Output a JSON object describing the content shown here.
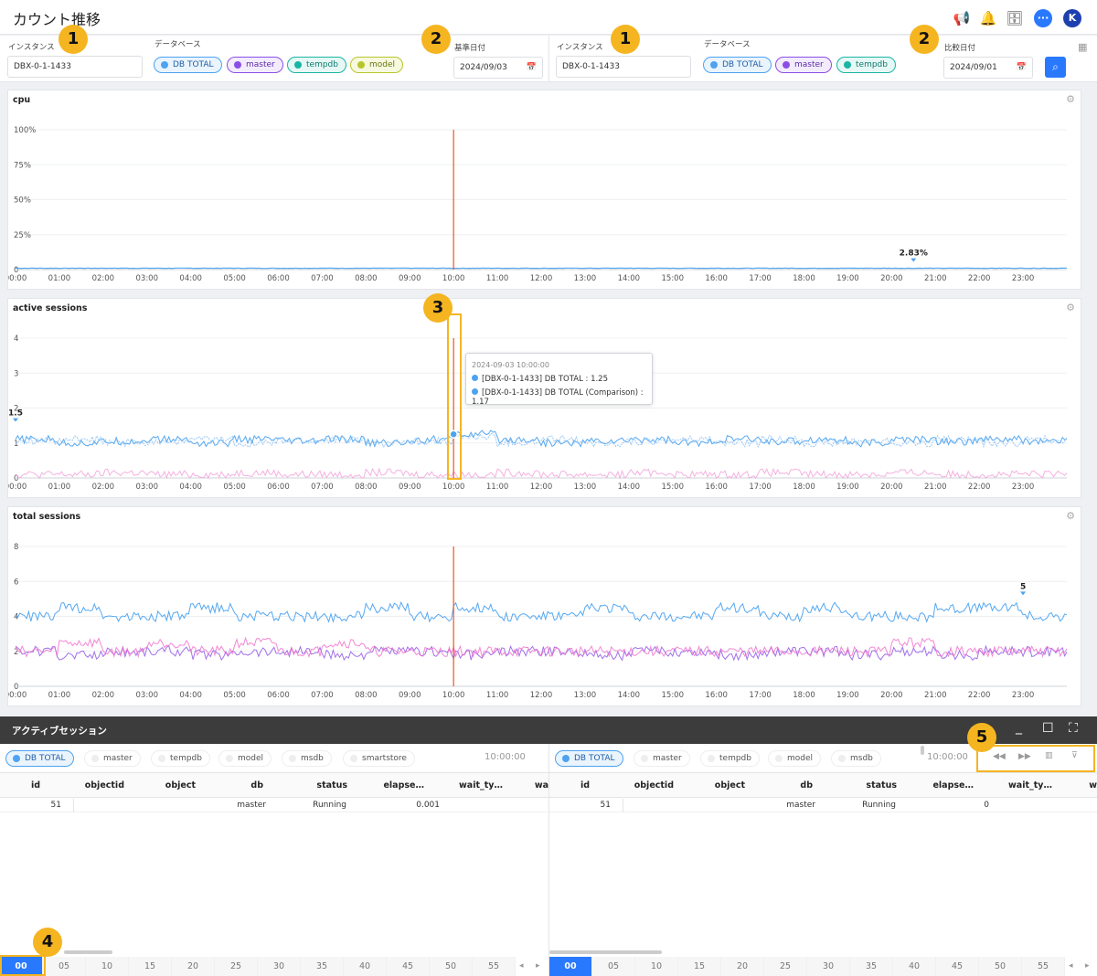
{
  "header": {
    "title": "カウント推移"
  },
  "filters": {
    "left": {
      "instance_label": "インスタンス",
      "instance_value": "DBX-0-1-1433",
      "database_label": "データベース",
      "chips": [
        "DB TOTAL",
        "master",
        "tempdb",
        "model"
      ],
      "date_label": "基準日付",
      "date_value": "2024/09/03"
    },
    "right": {
      "instance_label": "インスタンス",
      "instance_value": "DBX-0-1-1433",
      "database_label": "データベース",
      "chips": [
        "DB TOTAL",
        "master",
        "tempdb"
      ],
      "date_label": "比較日付",
      "date_value": "2024/09/01"
    }
  },
  "badges": [
    "1",
    "2",
    "1",
    "2",
    "3",
    "4",
    "5"
  ],
  "colors": {
    "db_total": "#4da3f0",
    "master": "#8b4fe6",
    "tempdb": "#19b5a4",
    "model": "#b8c62c",
    "marker": "#f4511e",
    "highlight": "#f5b521",
    "accent": "#2979ff"
  },
  "xticks": [
    "00:00",
    "01:00",
    "02:00",
    "03:00",
    "04:00",
    "05:00",
    "06:00",
    "07:00",
    "08:00",
    "09:00",
    "10:00",
    "11:00",
    "12:00",
    "13:00",
    "14:00",
    "15:00",
    "16:00",
    "17:00",
    "18:00",
    "19:00",
    "20:00",
    "21:00",
    "22:00",
    "23:00"
  ],
  "chart_data": [
    {
      "type": "line",
      "title": "cpu",
      "xlabel": "",
      "ylabel": "",
      "yticks": [
        "0",
        "25%",
        "50%",
        "75%",
        "100%"
      ],
      "ylim": [
        0,
        100
      ],
      "marker_time": "10:00",
      "peak": {
        "label": "2.83%",
        "time": "20:30",
        "value": 2.83
      },
      "series": [
        {
          "name": "DB TOTAL",
          "values": [
            1,
            1,
            1,
            1,
            1,
            1,
            1,
            1,
            1,
            1,
            1,
            1,
            1,
            1,
            1,
            1,
            1,
            1,
            1,
            1,
            1,
            1,
            1,
            1
          ]
        }
      ]
    },
    {
      "type": "line",
      "title": "active sessions",
      "xlabel": "",
      "ylabel": "",
      "yticks": [
        "0",
        "1",
        "2",
        "3",
        "4"
      ],
      "ylim": [
        0,
        4
      ],
      "marker_time": "10:00",
      "peak": {
        "label": "1.5",
        "time": "00:00",
        "value": 1.5
      },
      "series": [
        {
          "name": "[DBX-0-1-1433] DB TOTAL",
          "values": [
            1.1,
            1.0,
            1.05,
            1.1,
            1.0,
            1.1,
            1.05,
            1.1,
            1.0,
            1.1,
            1.25,
            1.1,
            1.0,
            1.05,
            1.1,
            1.0,
            1.1,
            1.05,
            1.1,
            1.0,
            1.1,
            1.05,
            1.1,
            1.05
          ]
        },
        {
          "name": "[DBX-0-1-1433] DB TOTAL (Comparison)",
          "values": [
            1.05,
            1.1,
            1.0,
            1.05,
            1.1,
            1.0,
            1.05,
            1.1,
            1.0,
            1.05,
            1.17,
            1.0,
            1.1,
            1.0,
            1.05,
            1.1,
            1.0,
            1.1,
            1.0,
            1.05,
            1.0,
            1.1,
            1.0,
            1.1
          ]
        },
        {
          "name": "master",
          "values": [
            0.1,
            0.1,
            0.15,
            0.1,
            0.1,
            0.15,
            0.1,
            0.1,
            0.15,
            0.1,
            0.1,
            0.15,
            0.1,
            0.1,
            0.15,
            0.1,
            0.1,
            0.15,
            0.1,
            0.1,
            0.15,
            0.1,
            0.1,
            0.1
          ]
        }
      ]
    },
    {
      "type": "line",
      "title": "total sessions",
      "xlabel": "",
      "ylabel": "",
      "yticks": [
        "0",
        "2",
        "4",
        "6",
        "8"
      ],
      "ylim": [
        0,
        8
      ],
      "marker_time": "10:00",
      "peak": {
        "label": "5",
        "time": "23:00",
        "value": 5
      },
      "series": [
        {
          "name": "DB TOTAL",
          "values": [
            4,
            4.5,
            4,
            4,
            4.5,
            4,
            4,
            4,
            4.5,
            4,
            4.5,
            4,
            4,
            4.5,
            4,
            4,
            4.5,
            4,
            4.5,
            4,
            4,
            4.5,
            4.5,
            4
          ]
        },
        {
          "name": "master",
          "values": [
            2,
            1.8,
            2,
            2,
            1.8,
            2,
            2,
            1.8,
            2,
            2,
            1.8,
            2,
            2,
            1.8,
            2,
            2,
            1.8,
            2,
            2,
            1.8,
            2,
            1.8,
            2,
            2
          ]
        },
        {
          "name": "tempdb",
          "values": [
            2,
            2.5,
            2,
            2.5,
            2,
            2.5,
            2,
            2.5,
            2,
            2,
            2,
            2,
            2,
            2,
            2,
            2,
            2,
            2,
            2,
            2,
            2.5,
            2,
            2,
            2
          ]
        }
      ]
    }
  ],
  "tooltip": {
    "timestamp": "2024-09-03 10:00:00",
    "rows": [
      "[DBX-0-1-1433] DB TOTAL : 1.25",
      "[DBX-0-1-1433] DB TOTAL (Comparison) : 1.17"
    ]
  },
  "bottom": {
    "title": "アクティブセッション",
    "left": {
      "chips": [
        "DB TOTAL",
        "master",
        "tempdb",
        "model",
        "msdb",
        "smartstore"
      ],
      "time": "10:00:00",
      "columns": [
        "id",
        "objectid",
        "object",
        "db",
        "status",
        "elapse…",
        "wait_ty…",
        "wa"
      ],
      "rows": [
        {
          "id": "51",
          "db": "master",
          "status": "Running",
          "elapsed": "0.001"
        }
      ]
    },
    "right": {
      "chips": [
        "DB TOTAL",
        "master",
        "tempdb",
        "model",
        "msdb"
      ],
      "time": "10:00:00",
      "columns": [
        "id",
        "objectid",
        "object",
        "db",
        "status",
        "elapse…",
        "wait_ty…",
        "w"
      ],
      "rows": [
        {
          "id": "51",
          "db": "master",
          "status": "Running",
          "elapsed": "0"
        }
      ]
    },
    "ticks": [
      "00",
      "05",
      "10",
      "15",
      "20",
      "25",
      "30",
      "35",
      "40",
      "45",
      "50",
      "55"
    ]
  }
}
